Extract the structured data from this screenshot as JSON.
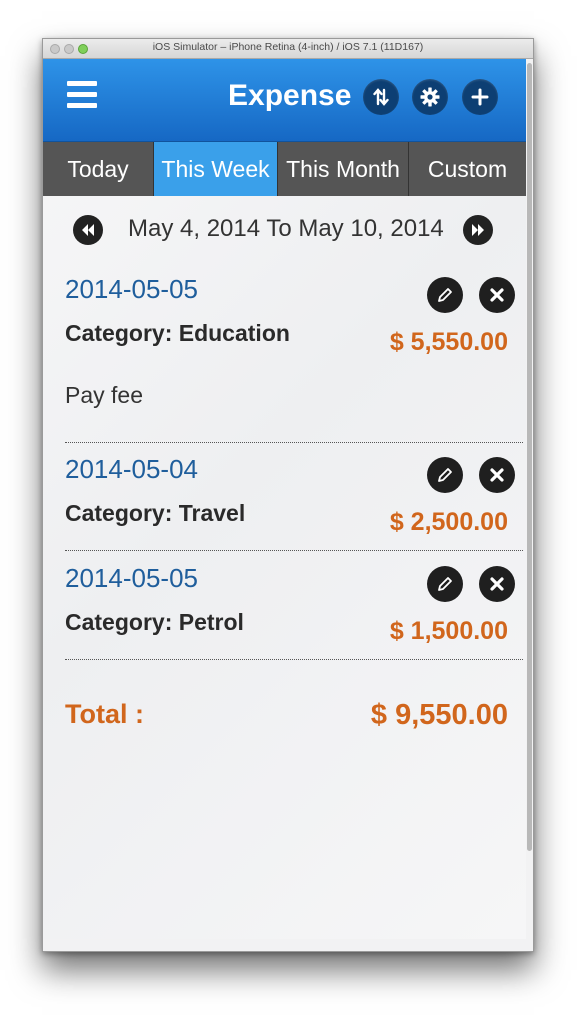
{
  "window": {
    "title": "iOS Simulator – iPhone Retina (4-inch) / iOS 7.1 (11D167)"
  },
  "header": {
    "title": "Expense",
    "icons": [
      "menu-icon",
      "sort-arrows-icon",
      "gear-icon",
      "plus-icon"
    ]
  },
  "tabs": [
    {
      "label": "Today",
      "active": false
    },
    {
      "label": "This Week",
      "active": true
    },
    {
      "label": "This Month",
      "active": false
    },
    {
      "label": "Custom",
      "active": false
    }
  ],
  "date_range": "May 4, 2014 To May 10, 2014",
  "entries": [
    {
      "date": "2014-05-05",
      "category": "Category: Education",
      "amount": "$ 5,550.00",
      "note": "Pay fee"
    },
    {
      "date": "2014-05-04",
      "category": "Category: Travel",
      "amount": "$ 2,500.00",
      "note": ""
    },
    {
      "date": "2014-05-05",
      "category": "Category: Petrol",
      "amount": "$ 1,500.00",
      "note": ""
    }
  ],
  "total": {
    "label": "Total :",
    "value": "$ 9,550.00"
  },
  "colors": {
    "header": "#1f7fd8",
    "active_tab": "#3aa0ea",
    "tab": "#555555",
    "date": "#1f5e9c",
    "amount": "#d1661c"
  }
}
